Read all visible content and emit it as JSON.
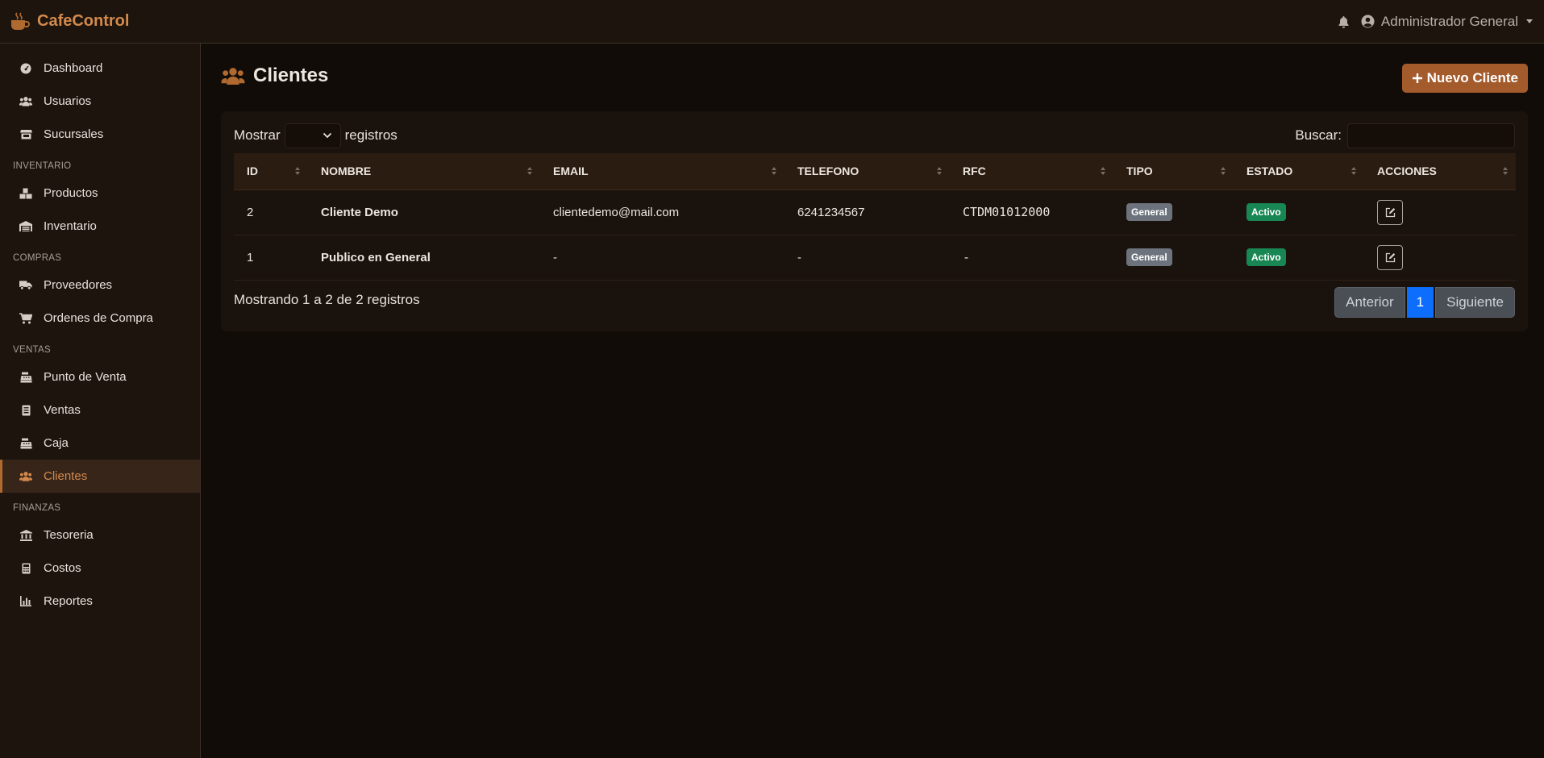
{
  "app": {
    "brand": "CafeControl",
    "brand_icon": "coffee-mug-icon",
    "accent": "#d38a4c"
  },
  "topbar": {
    "notification_icon": "bell-icon",
    "user_icon": "user-circle-icon",
    "user_name": "Administrador General"
  },
  "sidebar": {
    "items": [
      {
        "label": "Dashboard",
        "icon": "gauge-icon"
      },
      {
        "label": "Usuarios",
        "icon": "users-icon"
      },
      {
        "label": "Sucursales",
        "icon": "store-icon"
      },
      {
        "section": "INVENTARIO"
      },
      {
        "label": "Productos",
        "icon": "boxes-icon"
      },
      {
        "label": "Inventario",
        "icon": "warehouse-icon"
      },
      {
        "section": "COMPRAS"
      },
      {
        "label": "Proveedores",
        "icon": "truck-icon"
      },
      {
        "label": "Ordenes de Compra",
        "icon": "cart-icon"
      },
      {
        "section": "VENTAS"
      },
      {
        "label": "Punto de Venta",
        "icon": "cash-register-icon"
      },
      {
        "label": "Ventas",
        "icon": "receipt-icon"
      },
      {
        "label": "Caja",
        "icon": "cash-register-icon"
      },
      {
        "label": "Clientes",
        "icon": "users-icon",
        "active": true
      },
      {
        "section": "FINANZAS"
      },
      {
        "label": "Tesoreria",
        "icon": "bank-icon"
      },
      {
        "label": "Costos",
        "icon": "calculator-icon"
      },
      {
        "label": "Reportes",
        "icon": "bar-chart-icon"
      }
    ]
  },
  "page": {
    "title": "Clientes",
    "title_icon": "users-icon",
    "new_button": "Nuevo Cliente"
  },
  "table_controls": {
    "show_label": "Mostrar",
    "records_label": "registros",
    "search_label": "Buscar:",
    "length_value": "",
    "search_value": ""
  },
  "table": {
    "columns": [
      "ID",
      "NOMBRE",
      "EMAIL",
      "TELEFONO",
      "RFC",
      "TIPO",
      "ESTADO",
      "ACCIONES"
    ],
    "rows": [
      {
        "id": "2",
        "nombre": "Cliente Demo",
        "email": "clientedemo@mail.com",
        "telefono": "6241234567",
        "rfc": "CTDM01012000",
        "tipo": "General",
        "estado": "Activo"
      },
      {
        "id": "1",
        "nombre": "Publico en General",
        "email": "-",
        "telefono": "-",
        "rfc": "-",
        "tipo": "General",
        "estado": "Activo"
      }
    ]
  },
  "footer": {
    "info": "Mostrando 1 a 2 de 2 registros",
    "prev": "Anterior",
    "current_page": "1",
    "next": "Siguiente"
  }
}
